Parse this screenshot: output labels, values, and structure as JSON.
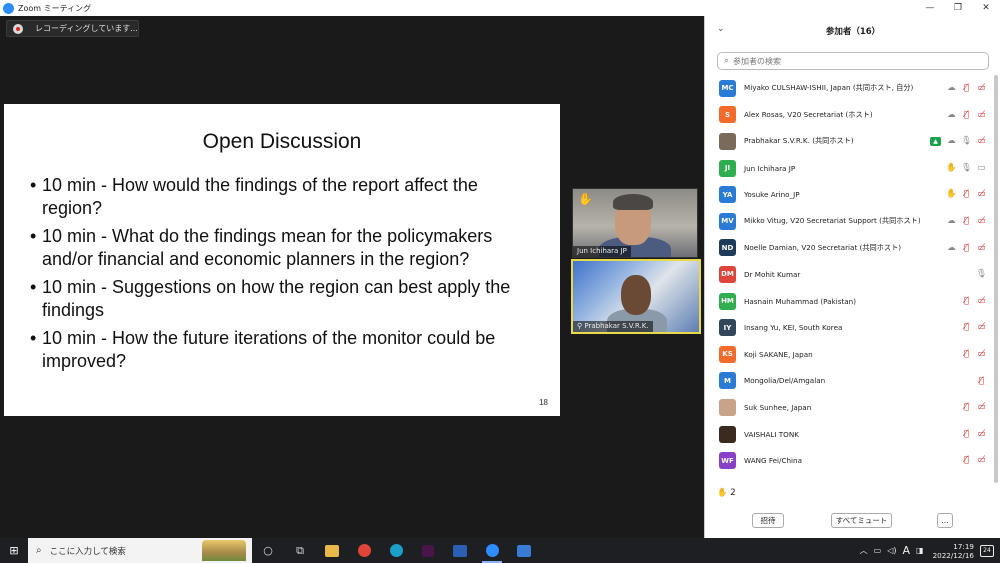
{
  "window": {
    "title": "Zoom ミーティング"
  },
  "recording": {
    "label": "レコーディングしています..."
  },
  "slide": {
    "title": "Open Discussion",
    "bullets": [
      "10 min - How would the findings of the report affect the region?",
      "10 min - What do the findings mean for the policymakers and/or financial and economic planners in the region?",
      "10 min - Suggestions on how the region can best apply the findings",
      "10 min - How the future iterations of the monitor could be improved?"
    ],
    "page_number": "18"
  },
  "videos": [
    {
      "name": "Jun Ichihara JP",
      "hand_raised": true
    },
    {
      "name": "Prabhakar S.V.R.K.",
      "pinned": true
    }
  ],
  "participants_panel": {
    "title": "参加者（16）",
    "search_placeholder": "参加者の検索",
    "participants": [
      {
        "initials": "MC",
        "name": "Miyako CULSHAW-ISHII, Japan (共同ホスト, 自分)",
        "avatar_color": "#2a7bd6",
        "icons": [
          "cloud",
          "mic-muted",
          "cam-off"
        ]
      },
      {
        "initials": "S",
        "name": "Alex Rosas, V20 Secretariat (ホスト)",
        "avatar_color": "#f26b2a",
        "icons": [
          "cloud",
          "mic-muted",
          "cam-off"
        ]
      },
      {
        "initials": "",
        "name": "Prabhakar S.V.R.K. (共同ホスト)",
        "avatar_color": "#7a6a5a",
        "photo": true,
        "icons": [
          "share",
          "cloud",
          "mic",
          "cam-off"
        ]
      },
      {
        "initials": "JI",
        "name": "Jun Ichihara JP",
        "avatar_color": "#2fae4f",
        "icons": [
          "hand",
          "mic",
          "cam"
        ]
      },
      {
        "initials": "YA",
        "name": "Yosuke Arino_JP",
        "avatar_color": "#2a7bd6",
        "icons": [
          "hand",
          "mic-muted",
          "cam-off"
        ]
      },
      {
        "initials": "MV",
        "name": "Mikko Vitug, V20 Secretariat Support (共同ホスト)",
        "avatar_color": "#2a7bd6",
        "icons": [
          "cloud",
          "mic-muted",
          "cam-off"
        ]
      },
      {
        "initials": "ND",
        "name": "Noelle Damian, V20 Secretariat (共同ホスト)",
        "avatar_color": "#1f3b5a",
        "icons": [
          "cloud",
          "mic-muted",
          "cam-off"
        ]
      },
      {
        "initials": "DM",
        "name": "Dr Mohit Kumar",
        "avatar_color": "#e0453a",
        "icons": [
          "mic"
        ]
      },
      {
        "initials": "HM",
        "name": "Hasnain Muhammad (Pakistan)",
        "avatar_color": "#2fae4f",
        "icons": [
          "mic-muted",
          "cam-off"
        ]
      },
      {
        "initials": "IY",
        "name": "Insang Yu, KEI, South Korea",
        "avatar_color": "#33475b",
        "icons": [
          "mic-muted",
          "cam-off"
        ]
      },
      {
        "initials": "KS",
        "name": "Koji SAKANE, Japan",
        "avatar_color": "#f26b2a",
        "icons": [
          "mic-muted",
          "cam-off"
        ]
      },
      {
        "initials": "M",
        "name": "Mongolia/Del/Amgalan",
        "avatar_color": "#2a7bd6",
        "icons": [
          "mic-muted"
        ]
      },
      {
        "initials": "",
        "name": "Suk Sunhee, Japan",
        "avatar_color": "#c9a28a",
        "photo": true,
        "icons": [
          "mic-muted",
          "cam-off"
        ]
      },
      {
        "initials": "",
        "name": "VAISHALI TONK",
        "avatar_color": "#3a2a20",
        "photo": true,
        "icons": [
          "mic-muted",
          "cam-off"
        ]
      },
      {
        "initials": "WF",
        "name": "WANG Fei/China",
        "avatar_color": "#8a3fc9",
        "icons": [
          "mic-muted",
          "cam-off"
        ]
      }
    ],
    "raised_hands_count": "2",
    "invite_label": "招待",
    "mute_all_label": "すべてミュート",
    "more_label": "..."
  },
  "taskbar": {
    "search_placeholder": "ここに入力して検索",
    "time": "17:19",
    "date": "2022/12/16",
    "ime_label": "A",
    "notification_count": "24"
  }
}
